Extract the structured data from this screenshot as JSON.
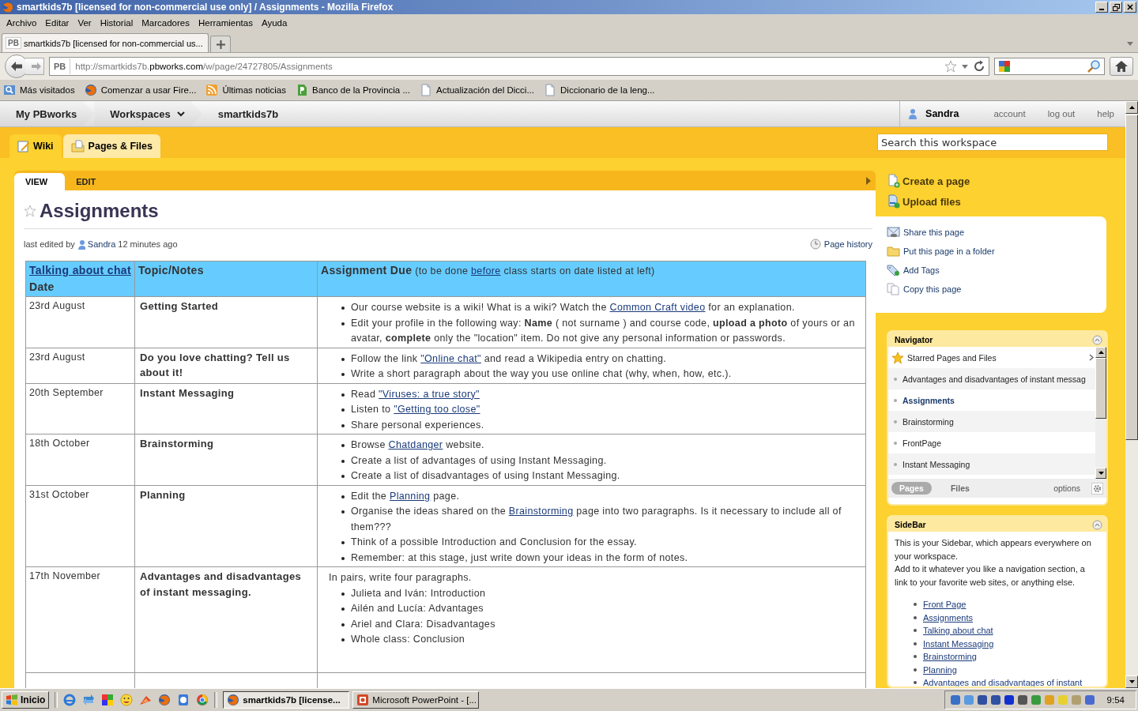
{
  "window": {
    "title": "smartkids7b [licensed for non-commercial use only] / Assignments - Mozilla Firefox"
  },
  "menu": [
    "Archivo",
    "Editar",
    "Ver",
    "Historial",
    "Marcadores",
    "Herramientas",
    "Ayuda"
  ],
  "browser_tabs": [
    {
      "badge": "PB",
      "label": "smartkids7b [licensed for non-commercial us...",
      "selected": true
    }
  ],
  "address": {
    "badge": "PB",
    "prefix": "http://smartkids7b.",
    "domain": "pbworks.com",
    "path": "/w/page/24727805/Assignments"
  },
  "bookmarks": [
    {
      "label": "Más visitados",
      "kind": "search"
    },
    {
      "label": "Comenzar a usar Fire...",
      "kind": "browser"
    },
    {
      "label": "Últimas noticias",
      "kind": "feed"
    },
    {
      "label": "Banco de la Provincia ...",
      "kind": "bank"
    },
    {
      "label": "Actualización del Dicci...",
      "kind": "page"
    },
    {
      "label": "Diccionario de la leng...",
      "kind": "page"
    }
  ],
  "pb_nav": {
    "crumbs": [
      "My PBworks",
      "Workspaces",
      "smartkids7b"
    ],
    "user": "Sandra",
    "links": [
      "account",
      "log out",
      "help"
    ]
  },
  "wiki_tabs": [
    {
      "label": "Wiki",
      "kind": "wiki",
      "selected": true
    },
    {
      "label": "Pages & Files",
      "kind": "files",
      "selected": false
    }
  ],
  "search": {
    "placeholder": "Search this workspace"
  },
  "page_tabs": [
    {
      "label": "VIEW",
      "selected": true
    },
    {
      "label": "EDIT",
      "selected": false
    }
  ],
  "page": {
    "title": "Assignments",
    "starred": false,
    "edited_prefix": "last edited by",
    "editor": "Sandra",
    "edited_ago": "12 minutes ago",
    "history": "Page history"
  },
  "table": {
    "columns": [
      [
        {
          "kind": "bold_link",
          "text": "Talking about chat"
        },
        {
          "kind": "bold",
          "text": " Date"
        }
      ],
      [
        {
          "kind": "bold",
          "text": "Topic/Notes"
        }
      ],
      [
        {
          "kind": "bold",
          "text": "Assignment Due"
        },
        {
          "kind": "text",
          "text": " (to be done "
        },
        {
          "kind": "link",
          "text": "before"
        },
        {
          "kind": "text",
          "text": " class starts on date listed at left)"
        }
      ]
    ],
    "rows": [
      {
        "date": "23rd August",
        "topic": "Getting Started",
        "items": [
          [
            {
              "kind": "text",
              "text": "Our course website is a wiki! What is a wiki? Watch the "
            },
            {
              "kind": "link",
              "text": "Common Craft video"
            },
            {
              "kind": "text",
              "text": " for an explanation."
            }
          ],
          [
            {
              "kind": "text",
              "text": "Edit your profile in the following way: "
            },
            {
              "kind": "bold",
              "text": "Name"
            },
            {
              "kind": "text",
              "text": " ( not surname ) and course code, "
            },
            {
              "kind": "bold",
              "text": "upload a photo"
            },
            {
              "kind": "text",
              "text": " of yours or an avatar, "
            },
            {
              "kind": "bold",
              "text": "complete"
            },
            {
              "kind": "text",
              "text": " only the \"location\" item. Do not give any personal information or passwords."
            }
          ]
        ]
      },
      {
        "date": "23rd August",
        "topic": "Do you love chatting? Tell us about it!",
        "items": [
          [
            {
              "kind": "text",
              "text": "Follow the link "
            },
            {
              "kind": "link",
              "text": "\"Online chat\""
            },
            {
              "kind": "text",
              "text": " and read a Wikipedia entry on chatting."
            }
          ],
          [
            {
              "kind": "text",
              "text": "Write a short paragraph about the way you use online chat (why, when, how, etc.)."
            }
          ]
        ]
      },
      {
        "date": "20th September",
        "topic": "Instant Messaging",
        "items": [
          [
            {
              "kind": "text",
              "text": "Read "
            },
            {
              "kind": "link",
              "text": "\"Viruses: a true story\""
            }
          ],
          [
            {
              "kind": "text",
              "text": "Listen to "
            },
            {
              "kind": "link",
              "text": "\"Getting too close\""
            }
          ],
          [
            {
              "kind": "text",
              "text": "Share personal experiences."
            }
          ]
        ]
      },
      {
        "date": "18th October",
        "topic": "Brainstorming",
        "items": [
          [
            {
              "kind": "text",
              "text": "Browse "
            },
            {
              "kind": "link",
              "text": "Chatdanger"
            },
            {
              "kind": "text",
              "text": "  website."
            }
          ],
          [
            {
              "kind": "text",
              "text": "Create a list of advantages of using Instant Messaging."
            }
          ],
          [
            {
              "kind": "text",
              "text": "Create a list  of disadvantages of using Instant Messaging."
            }
          ]
        ]
      },
      {
        "date": "31st October",
        "topic": "Planning",
        "items": [
          [
            {
              "kind": "text",
              "text": "Edit the "
            },
            {
              "kind": "link",
              "text": "Planning"
            },
            {
              "kind": "text",
              "text": " page."
            }
          ],
          [
            {
              "kind": "text",
              "text": "Organise the ideas shared on the "
            },
            {
              "kind": "link",
              "text": "Brainstorming"
            },
            {
              "kind": "text",
              "text": " page into two paragraphs. Is it necessary to include all of them???"
            }
          ],
          [
            {
              "kind": "text",
              "text": "Think of a possible Introduction and Conclusion for the essay."
            }
          ],
          [
            {
              "kind": "text",
              "text": "Remember: at this stage, just write down your ideas in the form of notes."
            }
          ]
        ]
      },
      {
        "date": "17th November",
        "topic": "Advantages and disadvantages of instant messaging.",
        "intro": "In pairs, write four paragraphs.",
        "items": [
          [
            {
              "kind": "text",
              "text": "Julieta and Iván: Introduction"
            }
          ],
          [
            {
              "kind": "text",
              "text": "Ailén and Lucía: Advantages"
            }
          ],
          [
            {
              "kind": "text",
              "text": "Ariel and Clara: Disadvantages"
            }
          ],
          [
            {
              "kind": "text",
              "text": "Whole class: Conclusion"
            }
          ]
        ]
      }
    ]
  },
  "actions": [
    {
      "label": "Create a page",
      "kind": "create"
    },
    {
      "label": "Upload files",
      "kind": "upload"
    }
  ],
  "page_actions": [
    {
      "label": "Share this page",
      "kind": "share"
    },
    {
      "label": "Put this page in a folder",
      "kind": "folder"
    },
    {
      "label": "Add Tags",
      "kind": "tag"
    },
    {
      "label": "Copy this page",
      "kind": "copy"
    }
  ],
  "navigator": {
    "title": "Navigator",
    "starred": "Starred Pages and Files",
    "pages": [
      {
        "label": "Advantages and disadvantages of instant messag",
        "selected": false
      },
      {
        "label": "Assignments",
        "selected": true
      },
      {
        "label": "Brainstorming",
        "selected": false
      },
      {
        "label": "FrontPage",
        "selected": false
      },
      {
        "label": "Instant Messaging",
        "selected": false
      }
    ],
    "tabs": [
      {
        "label": "Pages",
        "selected": true
      },
      {
        "label": "Files",
        "selected": false
      }
    ],
    "options": "options"
  },
  "sidebar": {
    "title": "SideBar",
    "paragraphs": [
      "This is your Sidebar, which appears everywhere on your workspace.",
      "Add to it whatever you like a navigation section, a link to your favorite web sites, or anything else."
    ],
    "links": [
      "Front Page",
      "Assignments",
      "Talking about chat",
      "Instant Messaging",
      "Brainstorming",
      "Planning",
      "Advantages and disadvantages of instant"
    ]
  },
  "taskbar": {
    "start": "Inicio",
    "tasks": [
      {
        "label": "smartkids7b [license...",
        "kind": "browser",
        "selected": true
      },
      {
        "label": "Microsoft PowerPoint - [...",
        "kind": "slides",
        "selected": false
      }
    ],
    "clock": "9:54"
  }
}
